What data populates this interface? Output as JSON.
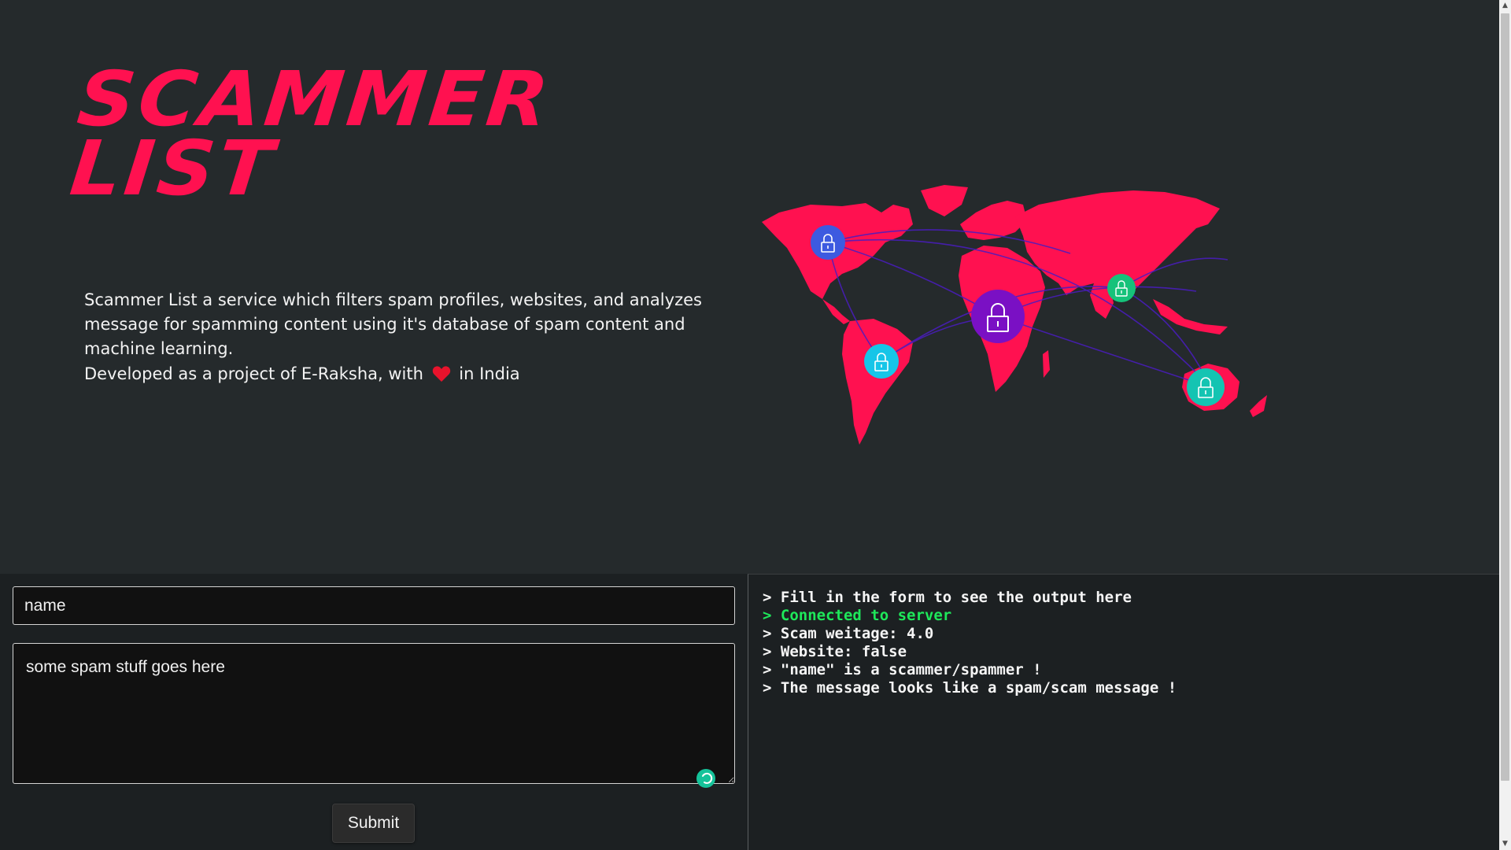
{
  "brand": {
    "line1": "Scammer",
    "line2": "List",
    "color": "#ff1150"
  },
  "about": {
    "description": "Scammer List a service which filters spam profiles, websites, and analyzes message for spamming content using it's database of spam content and machine learning.",
    "dev_prefix": "Developed as a project of E-Raksha, with",
    "dev_icon": "heart-icon",
    "dev_suffix": "in India"
  },
  "illustration": {
    "name": "world-map-security",
    "map_color": "#ff1150",
    "lock_icons": [
      "lock-icon-north-america",
      "lock-icon-south-america",
      "lock-icon-africa",
      "lock-icon-india",
      "lock-icon-australia"
    ]
  },
  "form": {
    "name_value": "name",
    "message_value": "some spam stuff goes here",
    "submit_label": "Submit"
  },
  "console": {
    "lines": [
      {
        "text": "> Fill in the form to see the output here",
        "status": "info"
      },
      {
        "text": "> Connected to server",
        "status": "success"
      },
      {
        "text": "> Scam weitage: 4.0",
        "status": "info"
      },
      {
        "text": "> Website: false",
        "status": "info"
      },
      {
        "text": "> \"name\" is a scammer/spammer !",
        "status": "info"
      },
      {
        "text": "> The message looks like a spam/scam message !",
        "status": "info"
      }
    ],
    "success_color": "#1ee85a"
  }
}
